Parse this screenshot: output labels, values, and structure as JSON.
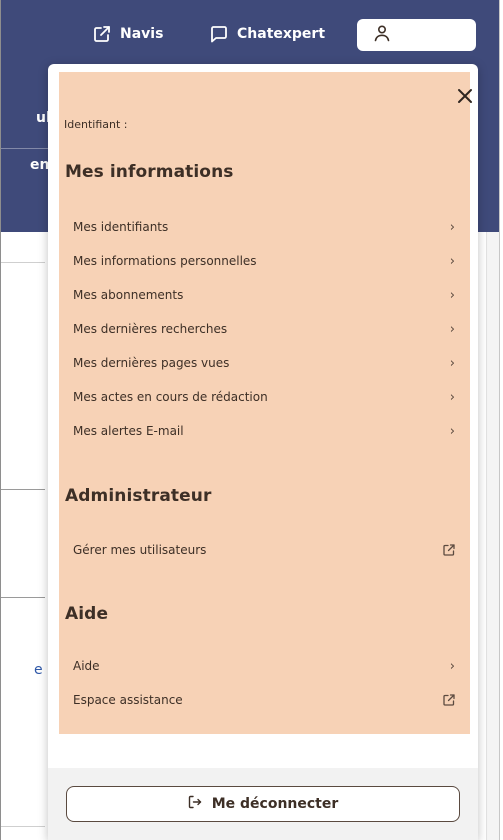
{
  "nav": {
    "navis_label": "Navis",
    "chatexpert_label": "Chatexpert"
  },
  "background": {
    "label_1": "ulat",
    "label_2": "ent",
    "link_fragment": "e"
  },
  "panel": {
    "identifier_label": "Identifiant :",
    "sections": [
      {
        "title": "Mes informations",
        "items": [
          {
            "label": "Mes identifiants",
            "icon": "chevron-right-icon"
          },
          {
            "label": "Mes informations personnelles",
            "icon": "chevron-right-icon"
          },
          {
            "label": "Mes abonnements",
            "icon": "chevron-right-icon"
          },
          {
            "label": "Mes dernières recherches",
            "icon": "chevron-right-icon"
          },
          {
            "label": "Mes dernières pages vues",
            "icon": "chevron-right-icon"
          },
          {
            "label": "Mes actes en cours de rédaction",
            "icon": "chevron-right-icon"
          },
          {
            "label": "Mes alertes E-mail",
            "icon": "chevron-right-icon"
          }
        ]
      },
      {
        "title": "Administrateur",
        "items": [
          {
            "label": "Gérer mes utilisateurs",
            "icon": "external-link-icon"
          }
        ]
      },
      {
        "title": "Aide",
        "items": [
          {
            "label": "Aide",
            "icon": "chevron-right-icon"
          },
          {
            "label": "Espace assistance",
            "icon": "external-link-icon"
          }
        ]
      }
    ],
    "logout_label": "Me déconnecter"
  },
  "colors": {
    "header_bg": "#3f4a7a",
    "panel_accent_bg": "#f7d2b6",
    "text": "#3d2f26"
  },
  "chevron_glyph": "›"
}
